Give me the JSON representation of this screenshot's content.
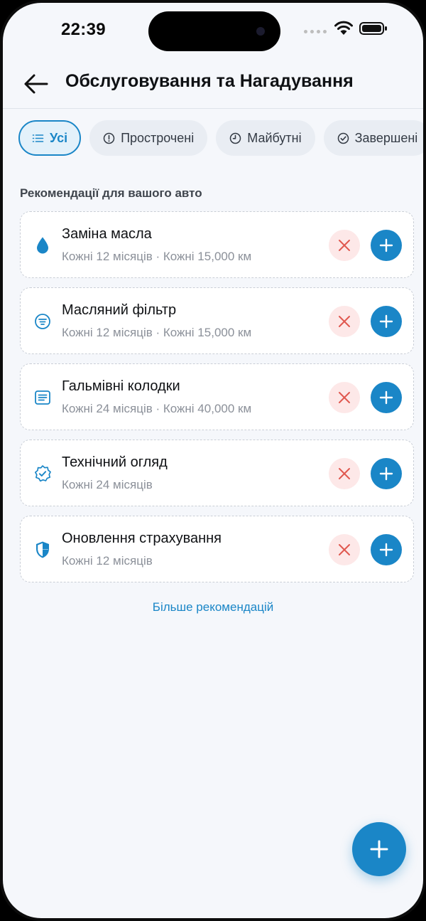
{
  "status_bar": {
    "time": "22:39"
  },
  "header": {
    "title": "Обслуговування та Нагадування"
  },
  "filters": [
    {
      "label": "Усі",
      "icon": "list-icon",
      "active": true
    },
    {
      "label": "Прострочені",
      "icon": "alert-circle-icon",
      "active": false
    },
    {
      "label": "Майбутні",
      "icon": "clock-icon",
      "active": false
    },
    {
      "label": "Завершені",
      "icon": "check-circle-icon",
      "active": false
    }
  ],
  "section_title": "Рекомендації для вашого авто",
  "recommendations": [
    {
      "title": "Заміна масла",
      "subtitle": "Кожні 12 місяців · Кожні 15,000 км",
      "icon": "oil-drop-icon"
    },
    {
      "title": "Масляний фільтр",
      "subtitle": "Кожні 12 місяців · Кожні 15,000 км",
      "icon": "filter-icon"
    },
    {
      "title": "Гальмівні колодки",
      "subtitle": "Кожні 24 місяців · Кожні 40,000 км",
      "icon": "brake-pad-icon"
    },
    {
      "title": "Технічний огляд",
      "subtitle": "Кожні 24 місяців",
      "icon": "verified-badge-icon"
    },
    {
      "title": "Оновлення страхування",
      "subtitle": "Кожні 12 місяців",
      "icon": "shield-icon"
    }
  ],
  "more_link": "Більше рекомендацій",
  "colors": {
    "accent": "#1a86c7",
    "dismiss_bg": "#fde8e8",
    "dismiss_icon": "#e0584f",
    "background": "#f5f7fb"
  }
}
